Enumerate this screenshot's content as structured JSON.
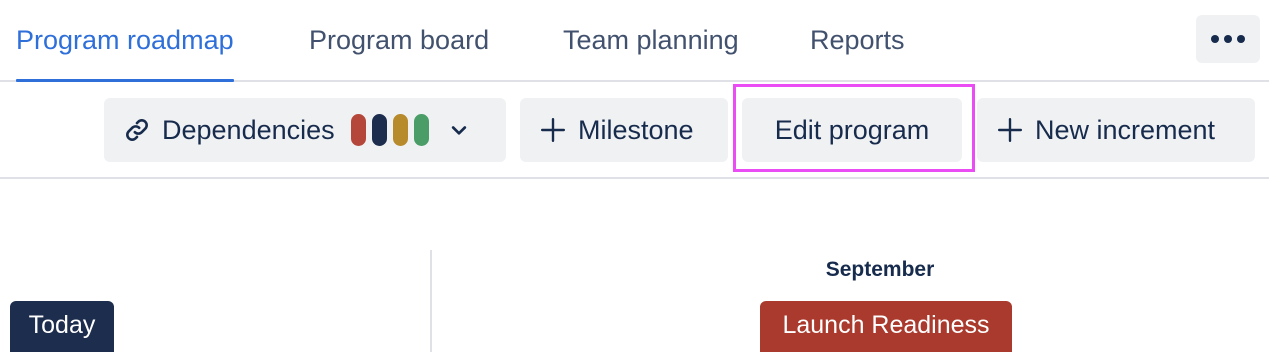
{
  "tabs": [
    {
      "label": "Program roadmap",
      "active": true
    },
    {
      "label": "Program board",
      "active": false
    },
    {
      "label": "Team planning",
      "active": false
    },
    {
      "label": "Reports",
      "active": false
    }
  ],
  "more_button": {
    "icon": "more-horizontal-icon"
  },
  "toolbar": {
    "dependencies": {
      "label": "Dependencies",
      "icon": "link-icon",
      "swatch_colors": [
        "#b5473a",
        "#1d2d4d",
        "#b78a2c",
        "#4a9d66"
      ],
      "dropdown_icon": "chevron-down-icon"
    },
    "milestone": {
      "label": "Milestone",
      "icon": "plus-icon"
    },
    "edit_program": {
      "label": "Edit program",
      "highlighted": true
    },
    "new_increment": {
      "label": "New increment",
      "icon": "plus-icon"
    }
  },
  "timeline": {
    "month_label": "September",
    "today_label": "Today",
    "milestone_label": "Launch Readiness"
  },
  "colors": {
    "accent": "#2f6fd9",
    "button_bg": "#f0f1f3",
    "today_bg": "#1d2d4d",
    "milestone_bg": "#a93a2d",
    "highlight": "#e94df3"
  }
}
